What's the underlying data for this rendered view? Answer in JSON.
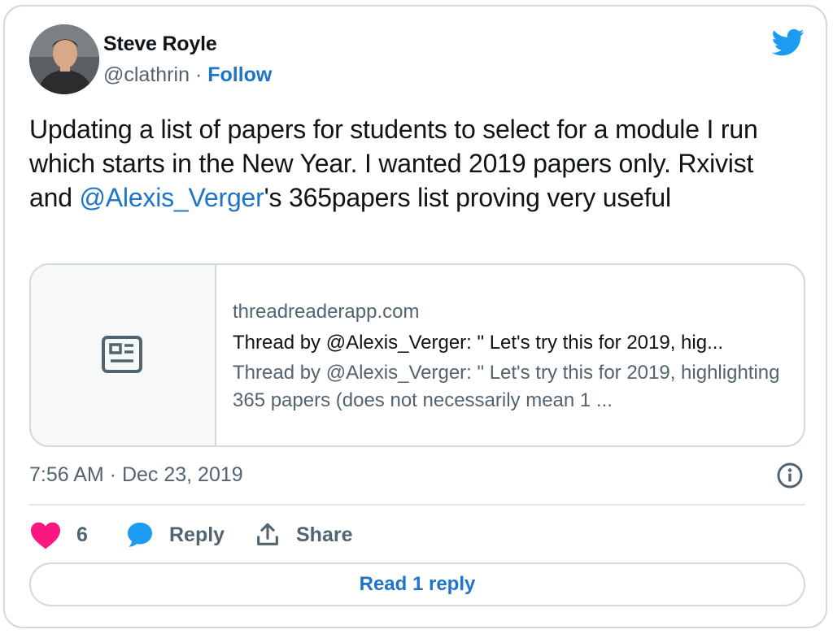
{
  "tweet": {
    "author_name": "Steve Royle",
    "handle": "@clathrin",
    "separator": "·",
    "follow_label": "Follow",
    "text_before_mention": "Updating a list of papers for students to select for a module I run which starts in the New Year. I wanted 2019 papers only. Rxivist and ",
    "mention": "@Alexis_Verger",
    "text_after_mention": "'s 365papers list proving very useful",
    "timestamp": "7:56 AM · Dec 23, 2019"
  },
  "link_card": {
    "domain": "threadreaderapp.com",
    "title": "Thread by @Alexis_Verger: \" Let's try this for 2019, hig...",
    "description": "Thread by @Alexis_Verger: \" Let's try this for 2019, highlighting 365 papers (does not necessarily mean 1 ..."
  },
  "actions": {
    "like_count": "6",
    "reply_label": "Reply",
    "share_label": "Share"
  },
  "read_replies_label": "Read 1 reply",
  "colors": {
    "accent": "#1d74c9",
    "twitter_blue": "#1d9bf0",
    "like_pink": "#f91880",
    "muted_text": "#536471",
    "border": "#cfd9de"
  },
  "icons": [
    "twitter-bird-icon",
    "news-article-icon",
    "info-icon",
    "heart-icon",
    "reply-bubble-icon",
    "share-icon"
  ]
}
